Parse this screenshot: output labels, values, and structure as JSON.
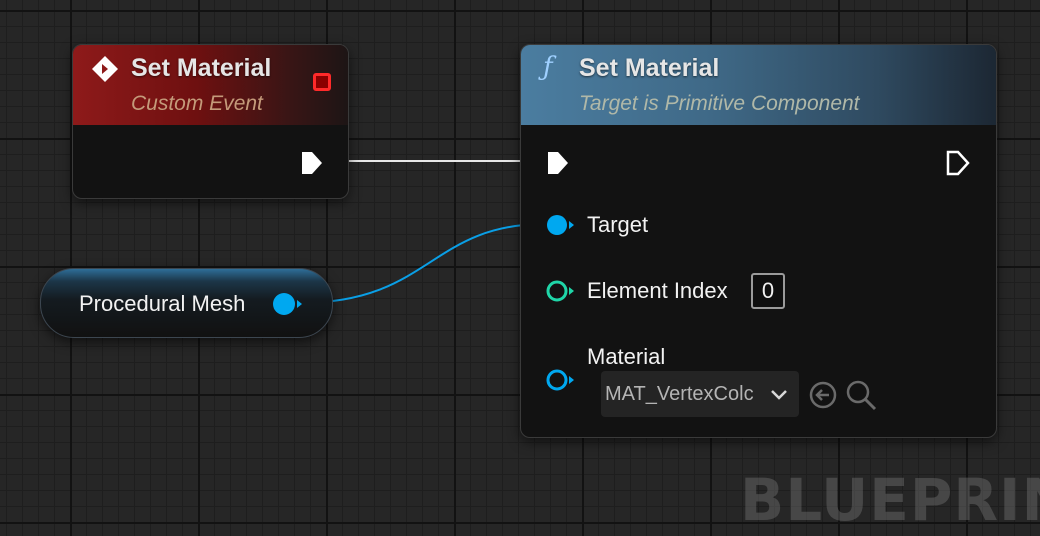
{
  "event_node": {
    "title": "Set Material",
    "subtitle": "Custom Event",
    "icon": "event-diamond-icon",
    "stop_icon": "stop-square-icon",
    "header_color": "#8e1a1a"
  },
  "function_node": {
    "title": "Set Material",
    "subtitle": "Target is Primitive Component",
    "icon": "function-f-icon",
    "header_color": "#4b7da0",
    "pins": {
      "target_label": "Target",
      "element_index_label": "Element Index",
      "element_index_value": "0",
      "material_label": "Material",
      "material_value": "MAT_VertexColc"
    }
  },
  "variable_node": {
    "label": "Procedural Mesh"
  },
  "colors": {
    "object_pin": "#00a8f0",
    "int_pin": "#1fd6a8",
    "material_pin": "#00a8f0",
    "exec_pin": "#ffffff",
    "wire_object": "#0a9fe6"
  },
  "watermark": "BLUEPRINT"
}
